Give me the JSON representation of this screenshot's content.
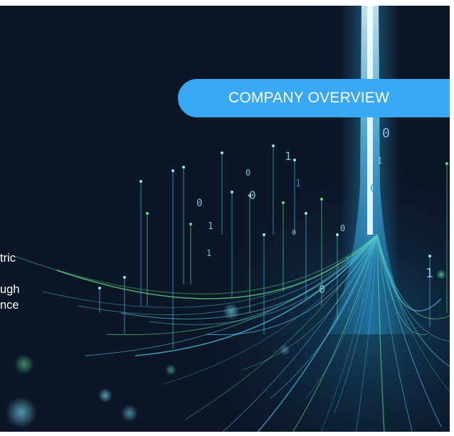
{
  "banner": {
    "label": "COMPANY OVERVIEW"
  },
  "body_text": {
    "lines": [
      "tric",
      "",
      "ugh",
      "nce"
    ]
  },
  "colors": {
    "background": "#0b1626",
    "accent": "#38a8f2",
    "beam": "#6fd6ff",
    "line_green": "#5fd98a",
    "line_cyan": "#4fc3ea"
  },
  "binary_digits": [
    "0",
    "1",
    "0",
    "1",
    "0",
    "0",
    "1",
    "0",
    "0",
    "1",
    "0",
    "0",
    "1",
    "0",
    "1"
  ],
  "icons": [
    "light-beam-graphic",
    "data-stream-graphic"
  ]
}
